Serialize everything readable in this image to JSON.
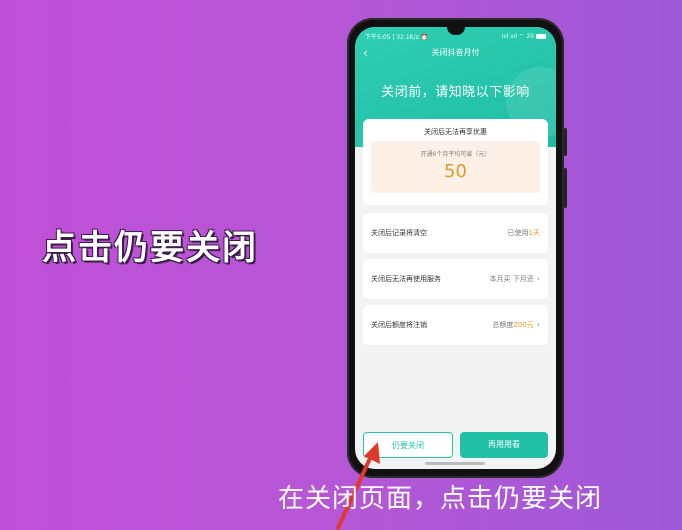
{
  "captions": {
    "left": "点击仍要关闭",
    "bottom": "在关闭页面，点击仍要关闭"
  },
  "status_bar": {
    "left": "下午5:05 | 32.1K/s ⏰",
    "right": "ıııl ıııl ⌔ 20"
  },
  "app": {
    "back_icon": "‹",
    "title": "关闭抖音月付",
    "headline": "关闭前，请知晓以下影响"
  },
  "benefit_card": {
    "title": "关闭后无法再享优惠",
    "save_label": "开通6个月平均可省（元）",
    "save_value": "50"
  },
  "rows": [
    {
      "label": "关闭后记录将清空",
      "value_prefix": "已使用",
      "value_highlight": "1天",
      "value_suffix": ""
    },
    {
      "label": "关闭后无法再使用服务",
      "value_prefix": "本月买 下月还",
      "value_highlight": "",
      "value_suffix": "›"
    },
    {
      "label": "关闭后额度将注销",
      "value_prefix": "总额度",
      "value_highlight": "200元",
      "value_suffix": "›"
    }
  ],
  "buttons": {
    "close": "仍要关闭",
    "keep": "再用用看"
  },
  "colors": {
    "accent": "#22c0a6",
    "highlight": "#e39a2f",
    "arrow": "#e0392b"
  }
}
